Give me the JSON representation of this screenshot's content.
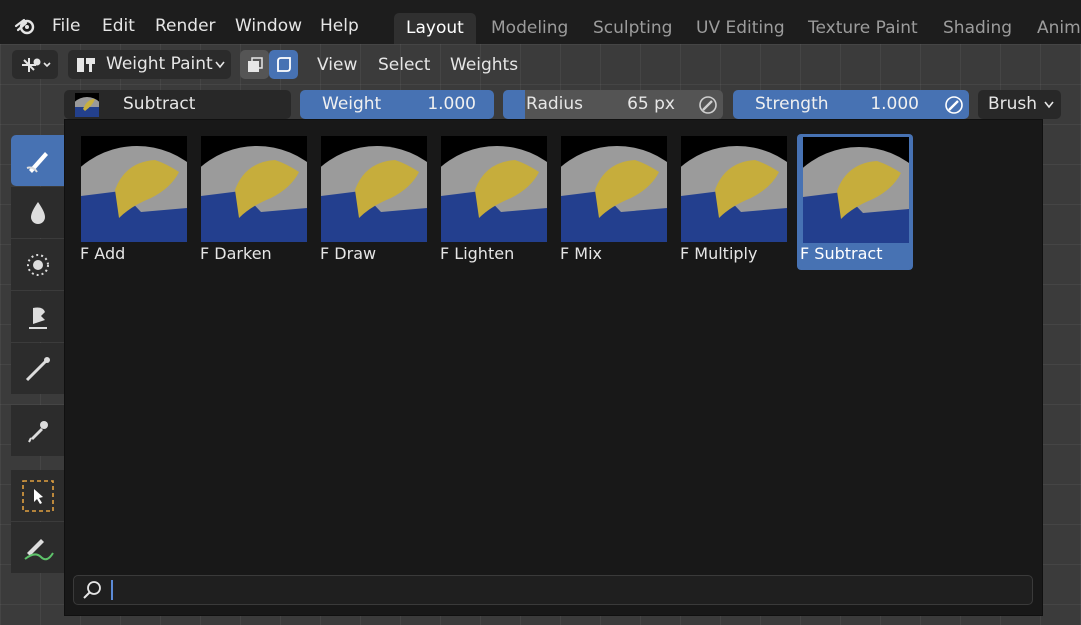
{
  "menu": {
    "file": "File",
    "edit": "Edit",
    "render": "Render",
    "window": "Window",
    "help": "Help"
  },
  "workspaces": [
    "Layout",
    "Modeling",
    "Sculpting",
    "UV Editing",
    "Texture Paint",
    "Shading",
    "Anima"
  ],
  "active_workspace": "Layout",
  "header": {
    "mode": "Weight Paint",
    "view": "View",
    "select": "Select",
    "weights": "Weights"
  },
  "tool_settings": {
    "brush_name": "Subtract",
    "weight_label": "Weight",
    "weight_value": "1.000",
    "radius_label": "Radius",
    "radius_value": "65 px",
    "strength_label": "Strength",
    "strength_value": "1.000",
    "brush_menu": "Brush"
  },
  "brushes": [
    {
      "label": "F Add"
    },
    {
      "label": "F Darken"
    },
    {
      "label": "F Draw"
    },
    {
      "label": "F Lighten"
    },
    {
      "label": "F Mix"
    },
    {
      "label": "F Multiply"
    },
    {
      "label": "F Subtract",
      "selected": true
    }
  ],
  "search": {
    "value": ""
  },
  "colors": {
    "accent": "#4772b3",
    "popup_bg": "#181818",
    "topbar_bg": "#1d1d1d"
  },
  "icons": [
    "blender-logo",
    "editor-type-icon",
    "weight-paint-mode-icon",
    "draw-brush-icon",
    "blur-icon",
    "average-icon",
    "smear-icon",
    "gradient-icon",
    "sample-weight-icon",
    "select-box-icon",
    "annotate-icon",
    "search-icon"
  ]
}
